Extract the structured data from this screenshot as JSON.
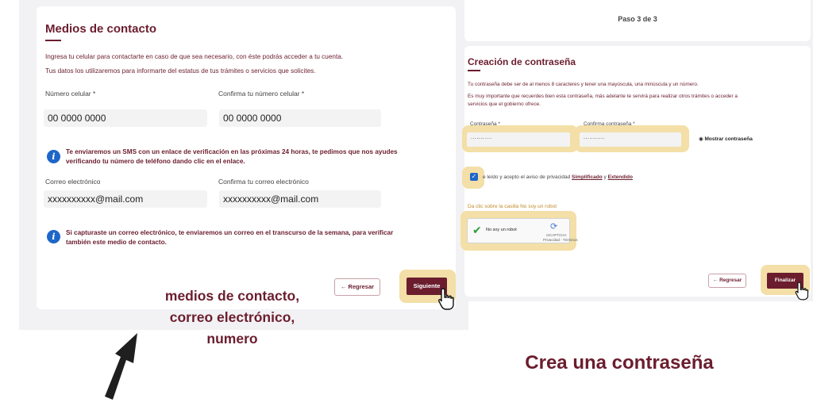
{
  "left": {
    "title": "Medios de contacto",
    "desc1": "Ingresa tu celular para contactarte en caso de que sea necesario, con éste podrás acceder a tu cuenta.",
    "desc2": "Tus datos los utilizaremos para informarte del estatus de tus trámites o servicios que solicites.",
    "phone_label": "Número celular *",
    "phone_value": "00 0000 0000",
    "phone_confirm_label": "Confirma tu número celular *",
    "phone_confirm_value": "00 0000 0000",
    "sms_info_line1": "Te enviaremos un SMS con un enlace de verificación en las próximas 24 horas, te pedimos que nos ayudes",
    "sms_info_line2": "verificando tu número de teléfono dando clic en el enlace.",
    "email_label": "Correo electrónico",
    "email_value": "xxxxxxxxxx@mail.com",
    "email_confirm_label": "Confirma tu correo electrónico",
    "email_confirm_value": "xxxxxxxxxx@mail.com",
    "email_info_line1": "Si capturaste un correo electrónico, te enviaremos un correo en el transcurso de la semana, para verificar",
    "email_info_line2": "también este medio de contacto.",
    "back_button": "Regresar",
    "next_button": "Siguiente"
  },
  "captions": {
    "left_line1": "medios de contacto,",
    "left_line2": "correo electrónico,",
    "left_line3": "numero",
    "right": "Crea una contraseña"
  },
  "right": {
    "step": "Paso 3 de 3",
    "title": "Creación de contraseña",
    "desc1": "Tu contraseña debe ser de al menos 8 caracteres y tener una mayúscula, una minúscula y un número.",
    "desc2": "Es muy importante que recuerdes bien esta contraseña, más adelante te servirá para realizar otros trámites o acceder a",
    "desc3": "servicios que el gobierno ofrece.",
    "password_label": "Contraseña *",
    "password_value": "...........",
    "password_confirm_label": "Confirma contraseña *",
    "password_confirm_value": "...........",
    "show_password": "Mostrar contraseña",
    "privacy_text": "e leído y acepto el aviso de privacidad",
    "privacy_link1": "Simplificado",
    "privacy_and": "y",
    "privacy_link2": "Extendido",
    "captcha_hint": "Da clic sobre la casilla No soy un robot",
    "captcha_label": "No soy un robot",
    "captcha_brand": "reCAPTCHA",
    "captcha_terms": "Privacidad - Términos",
    "back_button": "Regresar",
    "finish_button": "Finalizar"
  },
  "colors": {
    "brand": "#6b1d2e",
    "highlight": "#f3dfa7",
    "info": "#1e66c8"
  }
}
